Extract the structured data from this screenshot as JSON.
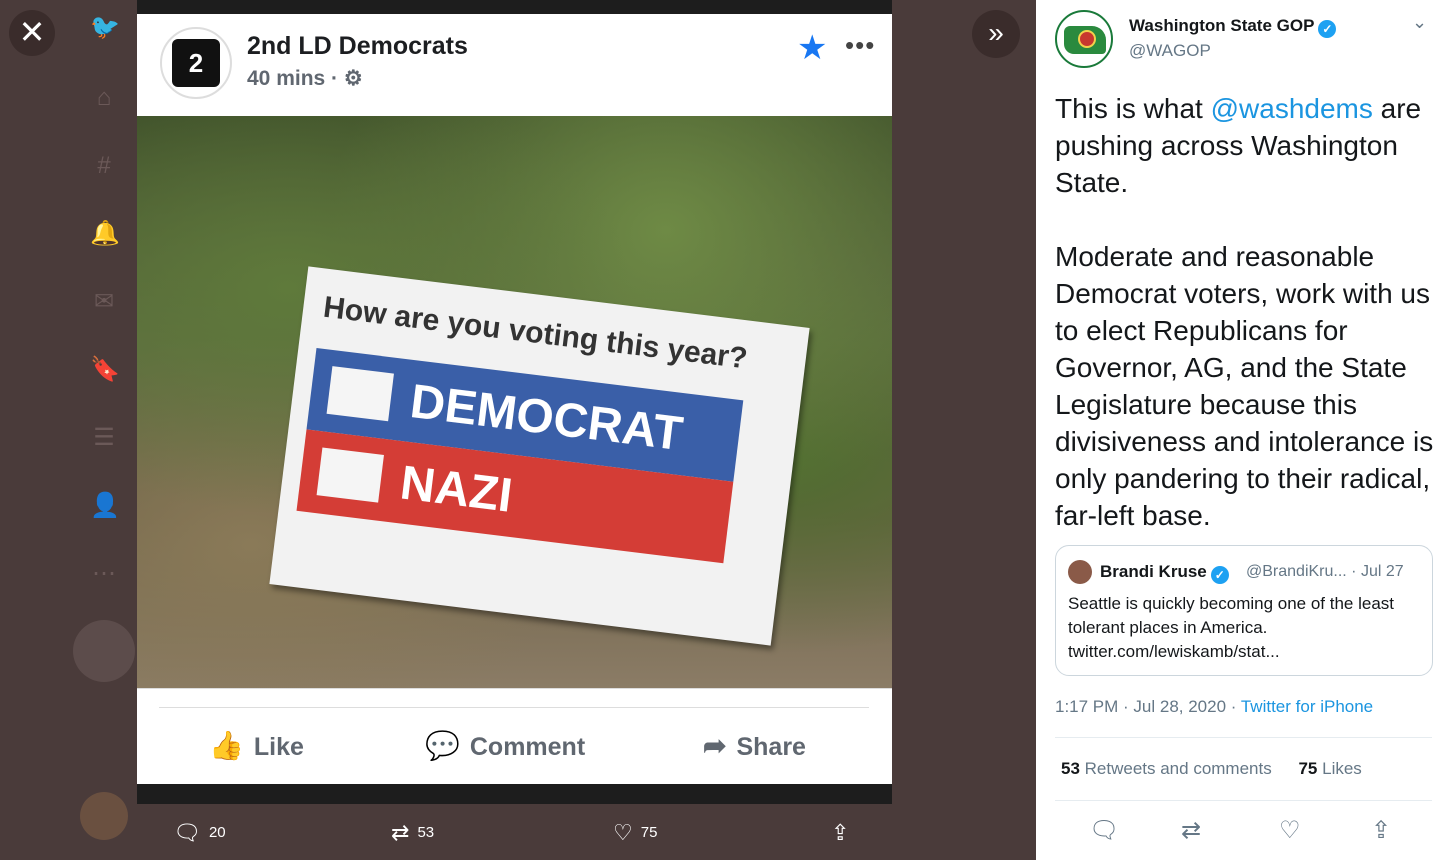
{
  "viewer": {
    "close_icon": "close-icon",
    "expand_icon": "chevron-double-right-icon"
  },
  "fb_post": {
    "page_name": "2nd LD Democrats",
    "avatar_text": "2",
    "time": "40 mins · ⚙",
    "sign_question": "How are you voting this year?",
    "option1": "DEMOCRAT",
    "option2": "NAZI",
    "actions": {
      "like": "Like",
      "comment": "Comment",
      "share": "Share"
    }
  },
  "media_bar": {
    "replies": "20",
    "retweets": "53",
    "likes": "75"
  },
  "tweet": {
    "name": "Washington State GOP",
    "handle": "@WAGOP",
    "text_before": "This is what ",
    "mention": "@washdems",
    "text_after": " are pushing across Washington State.\n\nModerate and reasonable Democrat voters, work with us to elect Republicans for Governor, AG, and the State Legislature because this divisiveness and intolerance is only pandering to their radical, far-left base.",
    "quote": {
      "name": "Brandi Kruse",
      "handle_date": "@BrandiKru... · Jul 27",
      "text": "Seattle is quickly becoming one of the least tolerant places in America.\ntwitter.com/lewiskamb/stat..."
    },
    "time": "1:17 PM · Jul 28, 2020 · ",
    "source": "Twitter for iPhone",
    "retweets_count": "53",
    "retweets_label": " Retweets and comments",
    "likes_count": "75",
    "likes_label": " Likes"
  },
  "colors": {
    "accent": "#1da1f2",
    "fb_blue": "#1877f2",
    "backdrop": "#4a3b3a"
  }
}
